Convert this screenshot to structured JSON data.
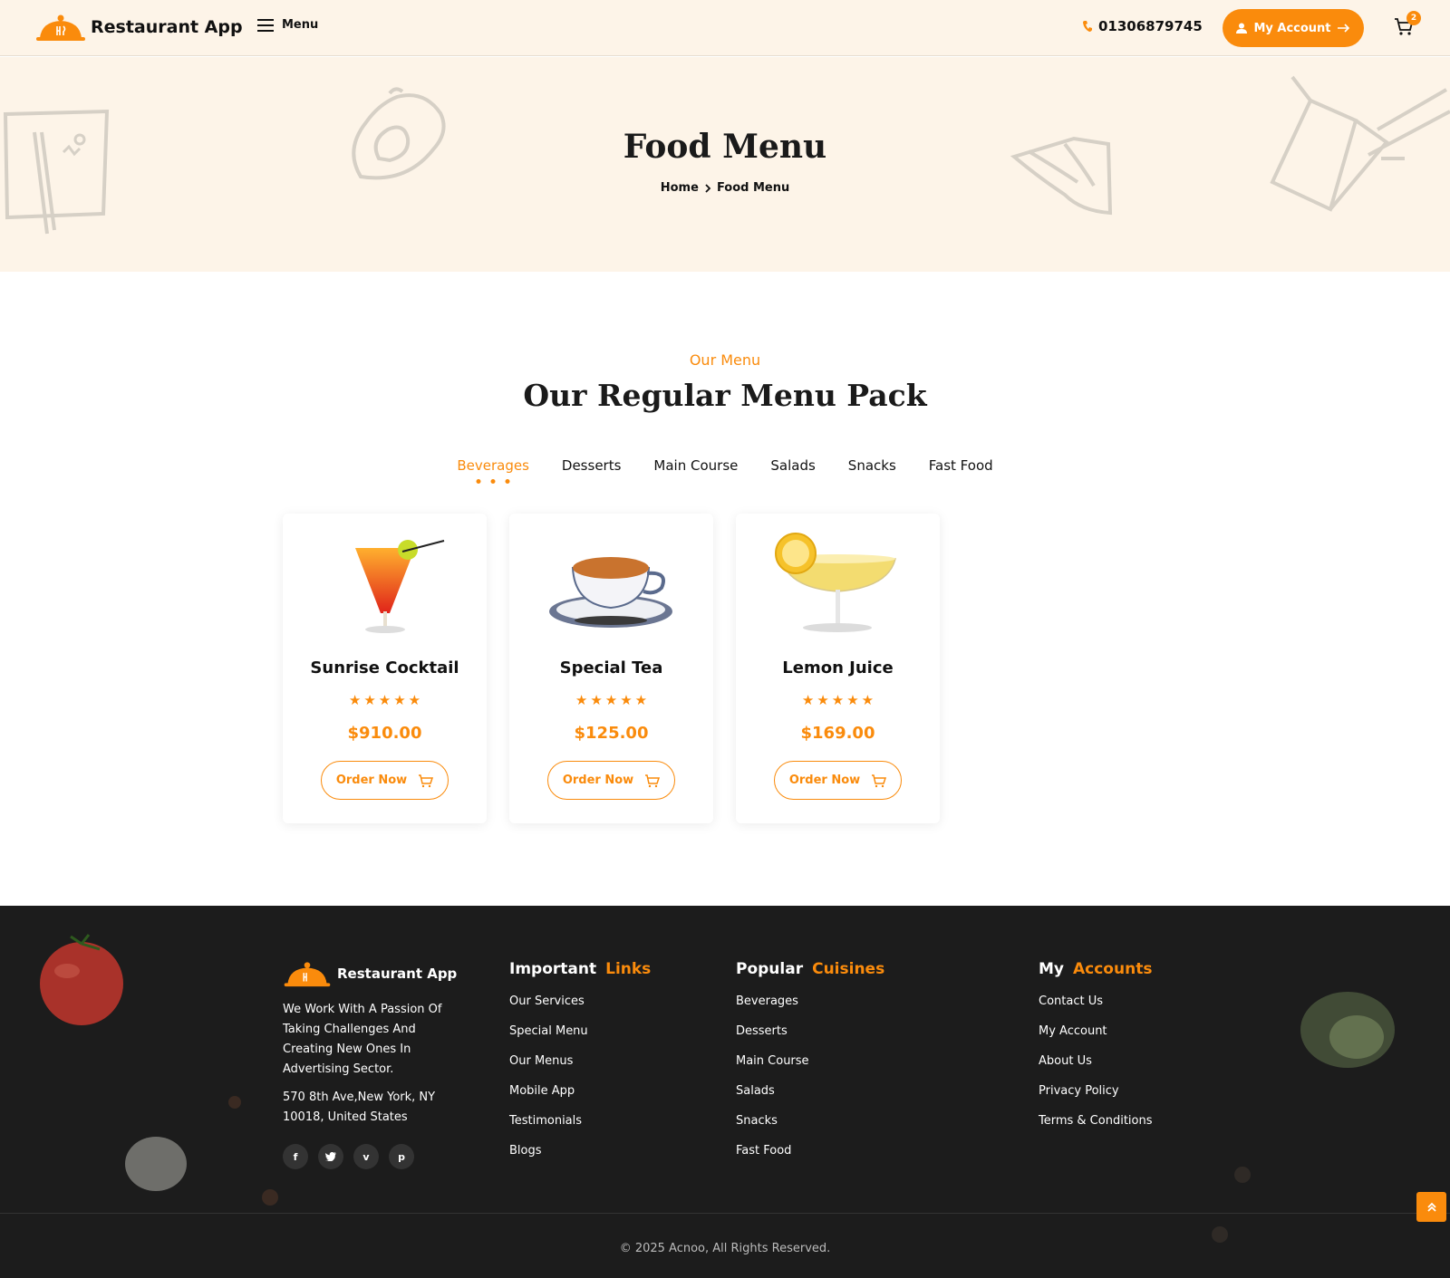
{
  "header": {
    "brand": "Restaurant App",
    "menu_label": "Menu",
    "phone": "01306879745",
    "account_label": "My Account",
    "cart_count": "2"
  },
  "hero": {
    "title": "Food Menu",
    "breadcrumb": [
      "Home",
      "Food Menu"
    ]
  },
  "menu": {
    "subtitle": "Our Menu",
    "title": "Our Regular Menu Pack",
    "tabs": [
      "Beverages",
      "Desserts",
      "Main Course",
      "Salads",
      "Snacks",
      "Fast Food"
    ],
    "active_tab": "Beverages",
    "items": [
      {
        "name": "Sunrise Cocktail",
        "rating": 5,
        "price": "$910.00",
        "button": "Order Now"
      },
      {
        "name": "Special Tea",
        "rating": 5,
        "price": "$125.00",
        "button": "Order Now"
      },
      {
        "name": "Lemon Juice",
        "rating": 5,
        "price": "$169.00",
        "button": "Order Now"
      }
    ]
  },
  "footer": {
    "brand": "Restaurant App",
    "description": "We Work With A Passion Of Taking Challenges And Creating New Ones In Advertising Sector.",
    "address": "570 8th Ave,New York, NY 10018, United States",
    "socials": [
      "facebook-icon",
      "twitter-icon",
      "vimeo-icon",
      "pinterest-icon"
    ],
    "important": {
      "title_a": "Important",
      "title_b": "Links",
      "links": [
        "Our Services",
        "Special Menu",
        "Our Menus",
        "Mobile App",
        "Testimonials",
        "Blogs"
      ]
    },
    "popular": {
      "title_a": "Popular",
      "title_b": "Cuisines",
      "links": [
        "Beverages",
        "Desserts",
        "Main Course",
        "Salads",
        "Snacks",
        "Fast Food"
      ]
    },
    "accounts": {
      "title_a": "My",
      "title_b": "Accounts",
      "links": [
        "Contact Us",
        "My Account",
        "About Us",
        "Privacy Policy",
        "Terms & Conditions"
      ]
    },
    "copyright": "© 2025 Acnoo, All Rights Reserved."
  },
  "colors": {
    "accent": "#fa8b0c",
    "hero_bg": "#fdf4e8",
    "footer_bg": "#1c1c1c"
  }
}
